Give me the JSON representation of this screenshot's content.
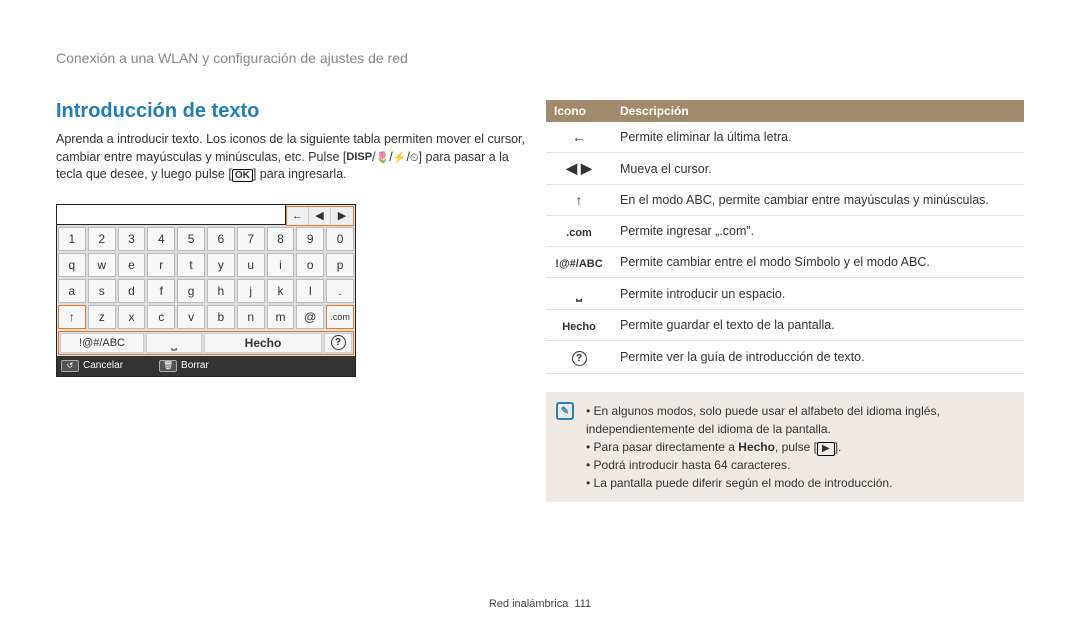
{
  "header": "Conexión a una WLAN y configuración de ajustes de red",
  "section_title": "Introducción de texto",
  "intro_part1": "Aprenda a introducir texto. Los iconos de la siguiente tabla permiten mover el cursor, cambiar entre mayúsculas y minúsculas, etc. Pulse [",
  "intro_disp": "DISP",
  "intro_part2": "] para pasar a la tecla que desee, y luego pulse [",
  "intro_ok": "OK",
  "intro_part3": "] para ingresarla.",
  "keyboard": {
    "row1": [
      "1",
      "2",
      "3",
      "4",
      "5",
      "6",
      "7",
      "8",
      "9",
      "0"
    ],
    "row2": [
      "q",
      "w",
      "e",
      "r",
      "t",
      "y",
      "u",
      "i",
      "o",
      "p"
    ],
    "row3": [
      "a",
      "s",
      "d",
      "f",
      "g",
      "h",
      "j",
      "k",
      "l",
      "."
    ],
    "row4": [
      "↑",
      "z",
      "x",
      "c",
      "v",
      "b",
      "n",
      "m",
      "@",
      ".com"
    ],
    "abc": "!@#/ABC",
    "space": "␣",
    "done": "Hecho",
    "help": "?",
    "arrows": [
      "←",
      "◀",
      "▶"
    ],
    "footer": {
      "cancel": "Cancelar",
      "delete": "Borrar"
    }
  },
  "table": {
    "header_icon": "Icono",
    "header_desc": "Descripción",
    "rows": [
      {
        "icon": "←",
        "desc": "Permite eliminar la última letra."
      },
      {
        "icon": "◀ ▶",
        "desc": "Mueva el cursor."
      },
      {
        "icon": "↑",
        "desc": "En el modo ABC, permite cambiar entre mayúsculas y minúsculas."
      },
      {
        "icon": ".com",
        "desc": "Permite ingresar „.com”."
      },
      {
        "icon": "!@#/ABC",
        "desc": "Permite cambiar entre el modo Símbolo y el modo ABC."
      },
      {
        "icon": "␣",
        "desc": "Permite introducir un espacio."
      },
      {
        "icon": "Hecho",
        "desc": "Permite guardar el texto de la pantalla."
      },
      {
        "icon": "?",
        "desc": "Permite ver la guía de introducción de texto."
      }
    ]
  },
  "notes": {
    "item1": "En algunos modos, solo puede usar el alfabeto del idioma inglés, independientemente del idioma de la pantalla.",
    "item2_a": "Para pasar directamente a ",
    "item2_b": "Hecho",
    "item2_c": ", pulse [",
    "item2_d": "].",
    "play": "▶",
    "item3": "Podrá introducir hasta 64 caracteres.",
    "item4": "La pantalla puede diferir según el modo de introducción."
  },
  "footer": {
    "section": "Red inalámbrica",
    "page": "111"
  }
}
